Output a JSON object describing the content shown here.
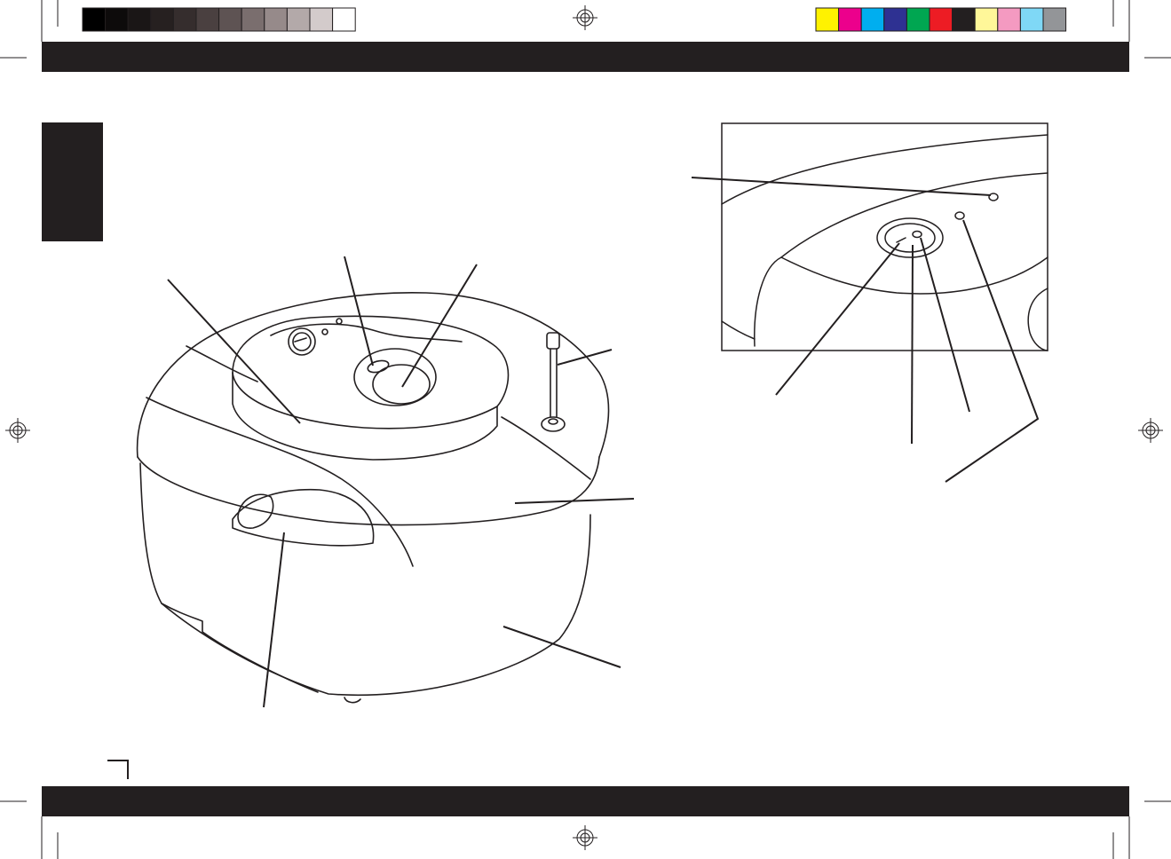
{
  "print_marks": {
    "grayscale_bar": [
      "#000000",
      "#0d0b0b",
      "#1a1616",
      "#262020",
      "#352d2d",
      "#4a4040",
      "#5e5353",
      "#7a6e6e",
      "#968a8a",
      "#b3a9a9",
      "#d3cbcb",
      "#ffffff"
    ],
    "color_bar": [
      "#fff200",
      "#ec008c",
      "#00aeef",
      "#2e3192",
      "#00a651",
      "#ed1c24",
      "#231f20",
      "#fff799",
      "#f49ac1",
      "#7fd8f6",
      "#939598"
    ],
    "band_color": "#231f20"
  },
  "figures": {
    "main_view": {
      "subject": "appliance-overview",
      "callout_count": 8
    },
    "detail_view": {
      "subject": "control-panel-detail",
      "callout_count": 5
    }
  }
}
